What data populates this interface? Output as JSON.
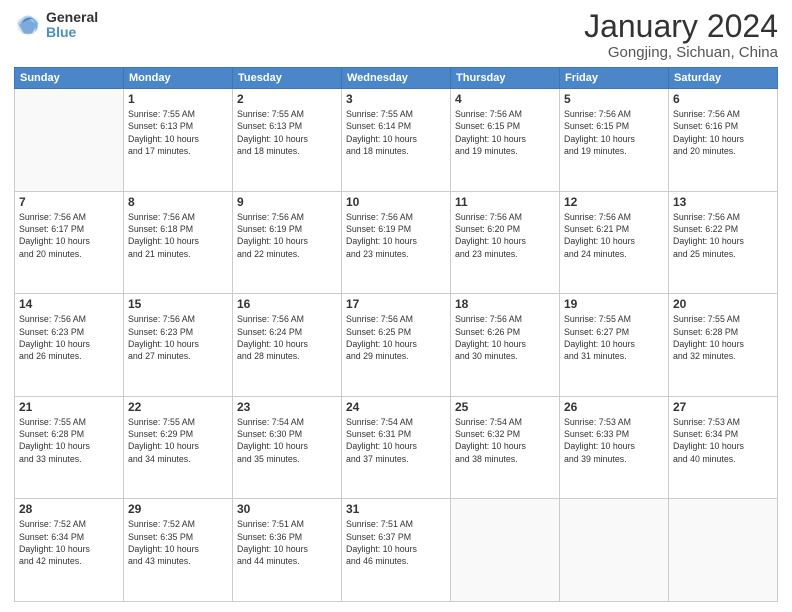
{
  "header": {
    "logo_general": "General",
    "logo_blue": "Blue",
    "month_year": "January 2024",
    "location": "Gongjing, Sichuan, China"
  },
  "weekdays": [
    "Sunday",
    "Monday",
    "Tuesday",
    "Wednesday",
    "Thursday",
    "Friday",
    "Saturday"
  ],
  "weeks": [
    [
      {
        "day": "",
        "info": ""
      },
      {
        "day": "1",
        "info": "Sunrise: 7:55 AM\nSunset: 6:13 PM\nDaylight: 10 hours\nand 17 minutes."
      },
      {
        "day": "2",
        "info": "Sunrise: 7:55 AM\nSunset: 6:13 PM\nDaylight: 10 hours\nand 18 minutes."
      },
      {
        "day": "3",
        "info": "Sunrise: 7:55 AM\nSunset: 6:14 PM\nDaylight: 10 hours\nand 18 minutes."
      },
      {
        "day": "4",
        "info": "Sunrise: 7:56 AM\nSunset: 6:15 PM\nDaylight: 10 hours\nand 19 minutes."
      },
      {
        "day": "5",
        "info": "Sunrise: 7:56 AM\nSunset: 6:15 PM\nDaylight: 10 hours\nand 19 minutes."
      },
      {
        "day": "6",
        "info": "Sunrise: 7:56 AM\nSunset: 6:16 PM\nDaylight: 10 hours\nand 20 minutes."
      }
    ],
    [
      {
        "day": "7",
        "info": "Sunrise: 7:56 AM\nSunset: 6:17 PM\nDaylight: 10 hours\nand 20 minutes."
      },
      {
        "day": "8",
        "info": "Sunrise: 7:56 AM\nSunset: 6:18 PM\nDaylight: 10 hours\nand 21 minutes."
      },
      {
        "day": "9",
        "info": "Sunrise: 7:56 AM\nSunset: 6:19 PM\nDaylight: 10 hours\nand 22 minutes."
      },
      {
        "day": "10",
        "info": "Sunrise: 7:56 AM\nSunset: 6:19 PM\nDaylight: 10 hours\nand 23 minutes."
      },
      {
        "day": "11",
        "info": "Sunrise: 7:56 AM\nSunset: 6:20 PM\nDaylight: 10 hours\nand 23 minutes."
      },
      {
        "day": "12",
        "info": "Sunrise: 7:56 AM\nSunset: 6:21 PM\nDaylight: 10 hours\nand 24 minutes."
      },
      {
        "day": "13",
        "info": "Sunrise: 7:56 AM\nSunset: 6:22 PM\nDaylight: 10 hours\nand 25 minutes."
      }
    ],
    [
      {
        "day": "14",
        "info": "Sunrise: 7:56 AM\nSunset: 6:23 PM\nDaylight: 10 hours\nand 26 minutes."
      },
      {
        "day": "15",
        "info": "Sunrise: 7:56 AM\nSunset: 6:23 PM\nDaylight: 10 hours\nand 27 minutes."
      },
      {
        "day": "16",
        "info": "Sunrise: 7:56 AM\nSunset: 6:24 PM\nDaylight: 10 hours\nand 28 minutes."
      },
      {
        "day": "17",
        "info": "Sunrise: 7:56 AM\nSunset: 6:25 PM\nDaylight: 10 hours\nand 29 minutes."
      },
      {
        "day": "18",
        "info": "Sunrise: 7:56 AM\nSunset: 6:26 PM\nDaylight: 10 hours\nand 30 minutes."
      },
      {
        "day": "19",
        "info": "Sunrise: 7:55 AM\nSunset: 6:27 PM\nDaylight: 10 hours\nand 31 minutes."
      },
      {
        "day": "20",
        "info": "Sunrise: 7:55 AM\nSunset: 6:28 PM\nDaylight: 10 hours\nand 32 minutes."
      }
    ],
    [
      {
        "day": "21",
        "info": "Sunrise: 7:55 AM\nSunset: 6:28 PM\nDaylight: 10 hours\nand 33 minutes."
      },
      {
        "day": "22",
        "info": "Sunrise: 7:55 AM\nSunset: 6:29 PM\nDaylight: 10 hours\nand 34 minutes."
      },
      {
        "day": "23",
        "info": "Sunrise: 7:54 AM\nSunset: 6:30 PM\nDaylight: 10 hours\nand 35 minutes."
      },
      {
        "day": "24",
        "info": "Sunrise: 7:54 AM\nSunset: 6:31 PM\nDaylight: 10 hours\nand 37 minutes."
      },
      {
        "day": "25",
        "info": "Sunrise: 7:54 AM\nSunset: 6:32 PM\nDaylight: 10 hours\nand 38 minutes."
      },
      {
        "day": "26",
        "info": "Sunrise: 7:53 AM\nSunset: 6:33 PM\nDaylight: 10 hours\nand 39 minutes."
      },
      {
        "day": "27",
        "info": "Sunrise: 7:53 AM\nSunset: 6:34 PM\nDaylight: 10 hours\nand 40 minutes."
      }
    ],
    [
      {
        "day": "28",
        "info": "Sunrise: 7:52 AM\nSunset: 6:34 PM\nDaylight: 10 hours\nand 42 minutes."
      },
      {
        "day": "29",
        "info": "Sunrise: 7:52 AM\nSunset: 6:35 PM\nDaylight: 10 hours\nand 43 minutes."
      },
      {
        "day": "30",
        "info": "Sunrise: 7:51 AM\nSunset: 6:36 PM\nDaylight: 10 hours\nand 44 minutes."
      },
      {
        "day": "31",
        "info": "Sunrise: 7:51 AM\nSunset: 6:37 PM\nDaylight: 10 hours\nand 46 minutes."
      },
      {
        "day": "",
        "info": ""
      },
      {
        "day": "",
        "info": ""
      },
      {
        "day": "",
        "info": ""
      }
    ]
  ]
}
